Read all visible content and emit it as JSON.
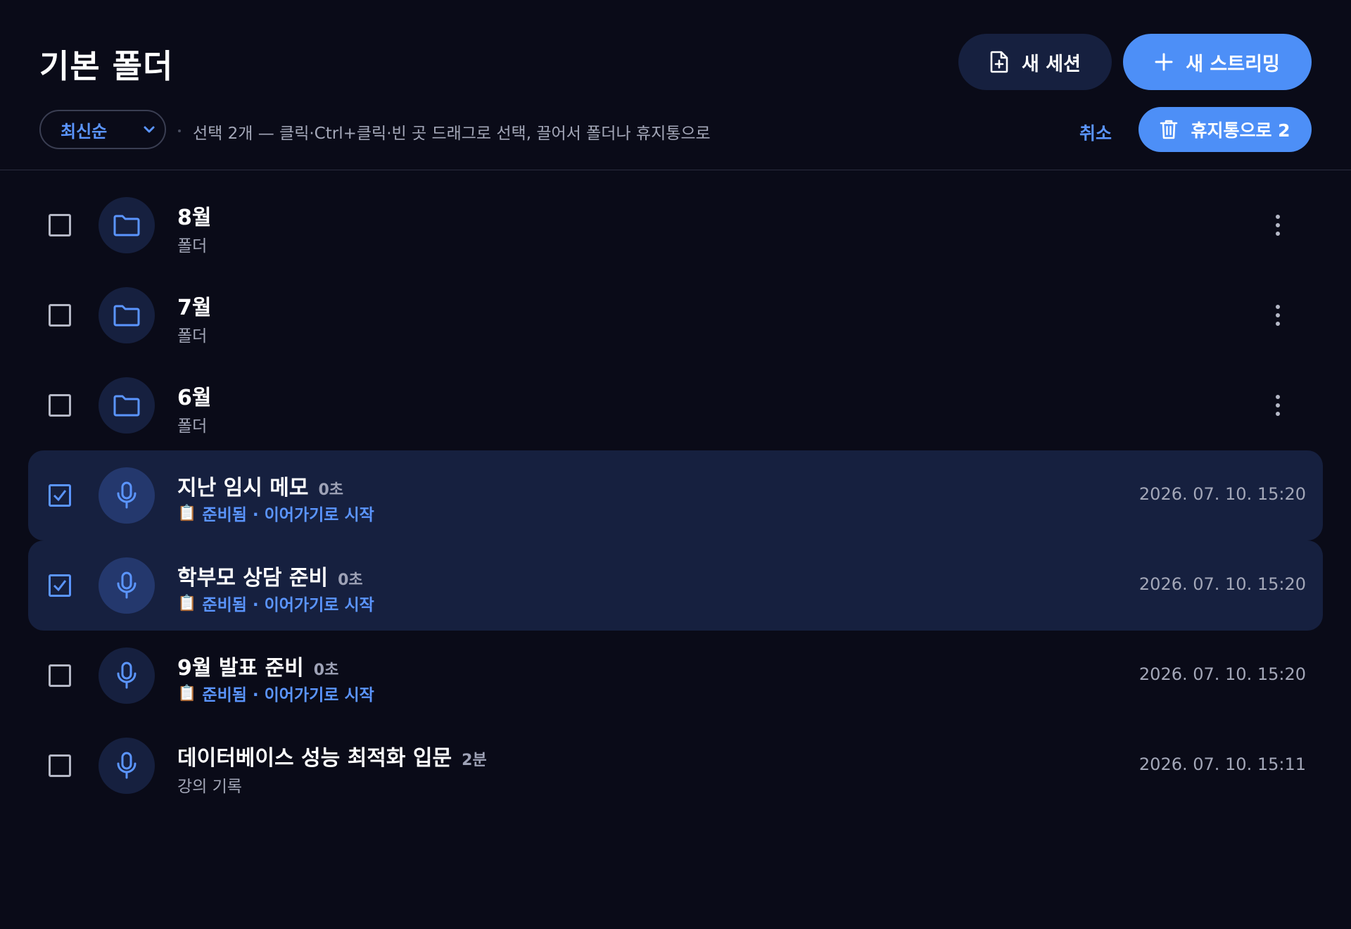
{
  "header": {
    "title": "기본 폴더",
    "new_session_label": "새 세션",
    "new_stream_label": "새 스트리밍"
  },
  "toolbar": {
    "sort_value": "최신순",
    "selection_hint": "선택 2개 — 클릭·Ctrl+클릭·빈 곳 드래그로 선택, 끌어서 폴더나 휴지통으로",
    "cancel_label": "취소",
    "trash_label": "휴지통으로 2"
  },
  "colors": {
    "accent": "#4d8ff7",
    "link": "#5b95ff",
    "background": "#0a0b18",
    "selected_row": "#16203f"
  },
  "folders": [
    {
      "name": "8월",
      "type_label": "폴더",
      "icon": "folder-icon"
    },
    {
      "name": "7월",
      "type_label": "폴더",
      "icon": "folder-icon"
    },
    {
      "name": "6월",
      "type_label": "폴더",
      "icon": "folder-icon"
    }
  ],
  "sessions": [
    {
      "title": "지난 임시 메모",
      "duration": "0초",
      "status": "준비됨 · 이어가기로 시작",
      "status_icon": "clipboard-icon",
      "timestamp": "2026. 07. 10. 15:20",
      "selected": true
    },
    {
      "title": "학부모 상담 준비",
      "duration": "0초",
      "status": "준비됨 · 이어가기로 시작",
      "status_icon": "clipboard-icon",
      "timestamp": "2026. 07. 10. 15:20",
      "selected": true
    },
    {
      "title": "9월 발표 준비",
      "duration": "0초",
      "status": "준비됨 · 이어가기로 시작",
      "status_icon": "clipboard-icon",
      "timestamp": "2026. 07. 10. 15:20",
      "selected": false
    },
    {
      "title": "데이터베이스 성능 최적화 입문",
      "duration": "2분",
      "subtitle": "강의 기록",
      "timestamp": "2026. 07. 10. 15:11",
      "selected": false
    }
  ]
}
